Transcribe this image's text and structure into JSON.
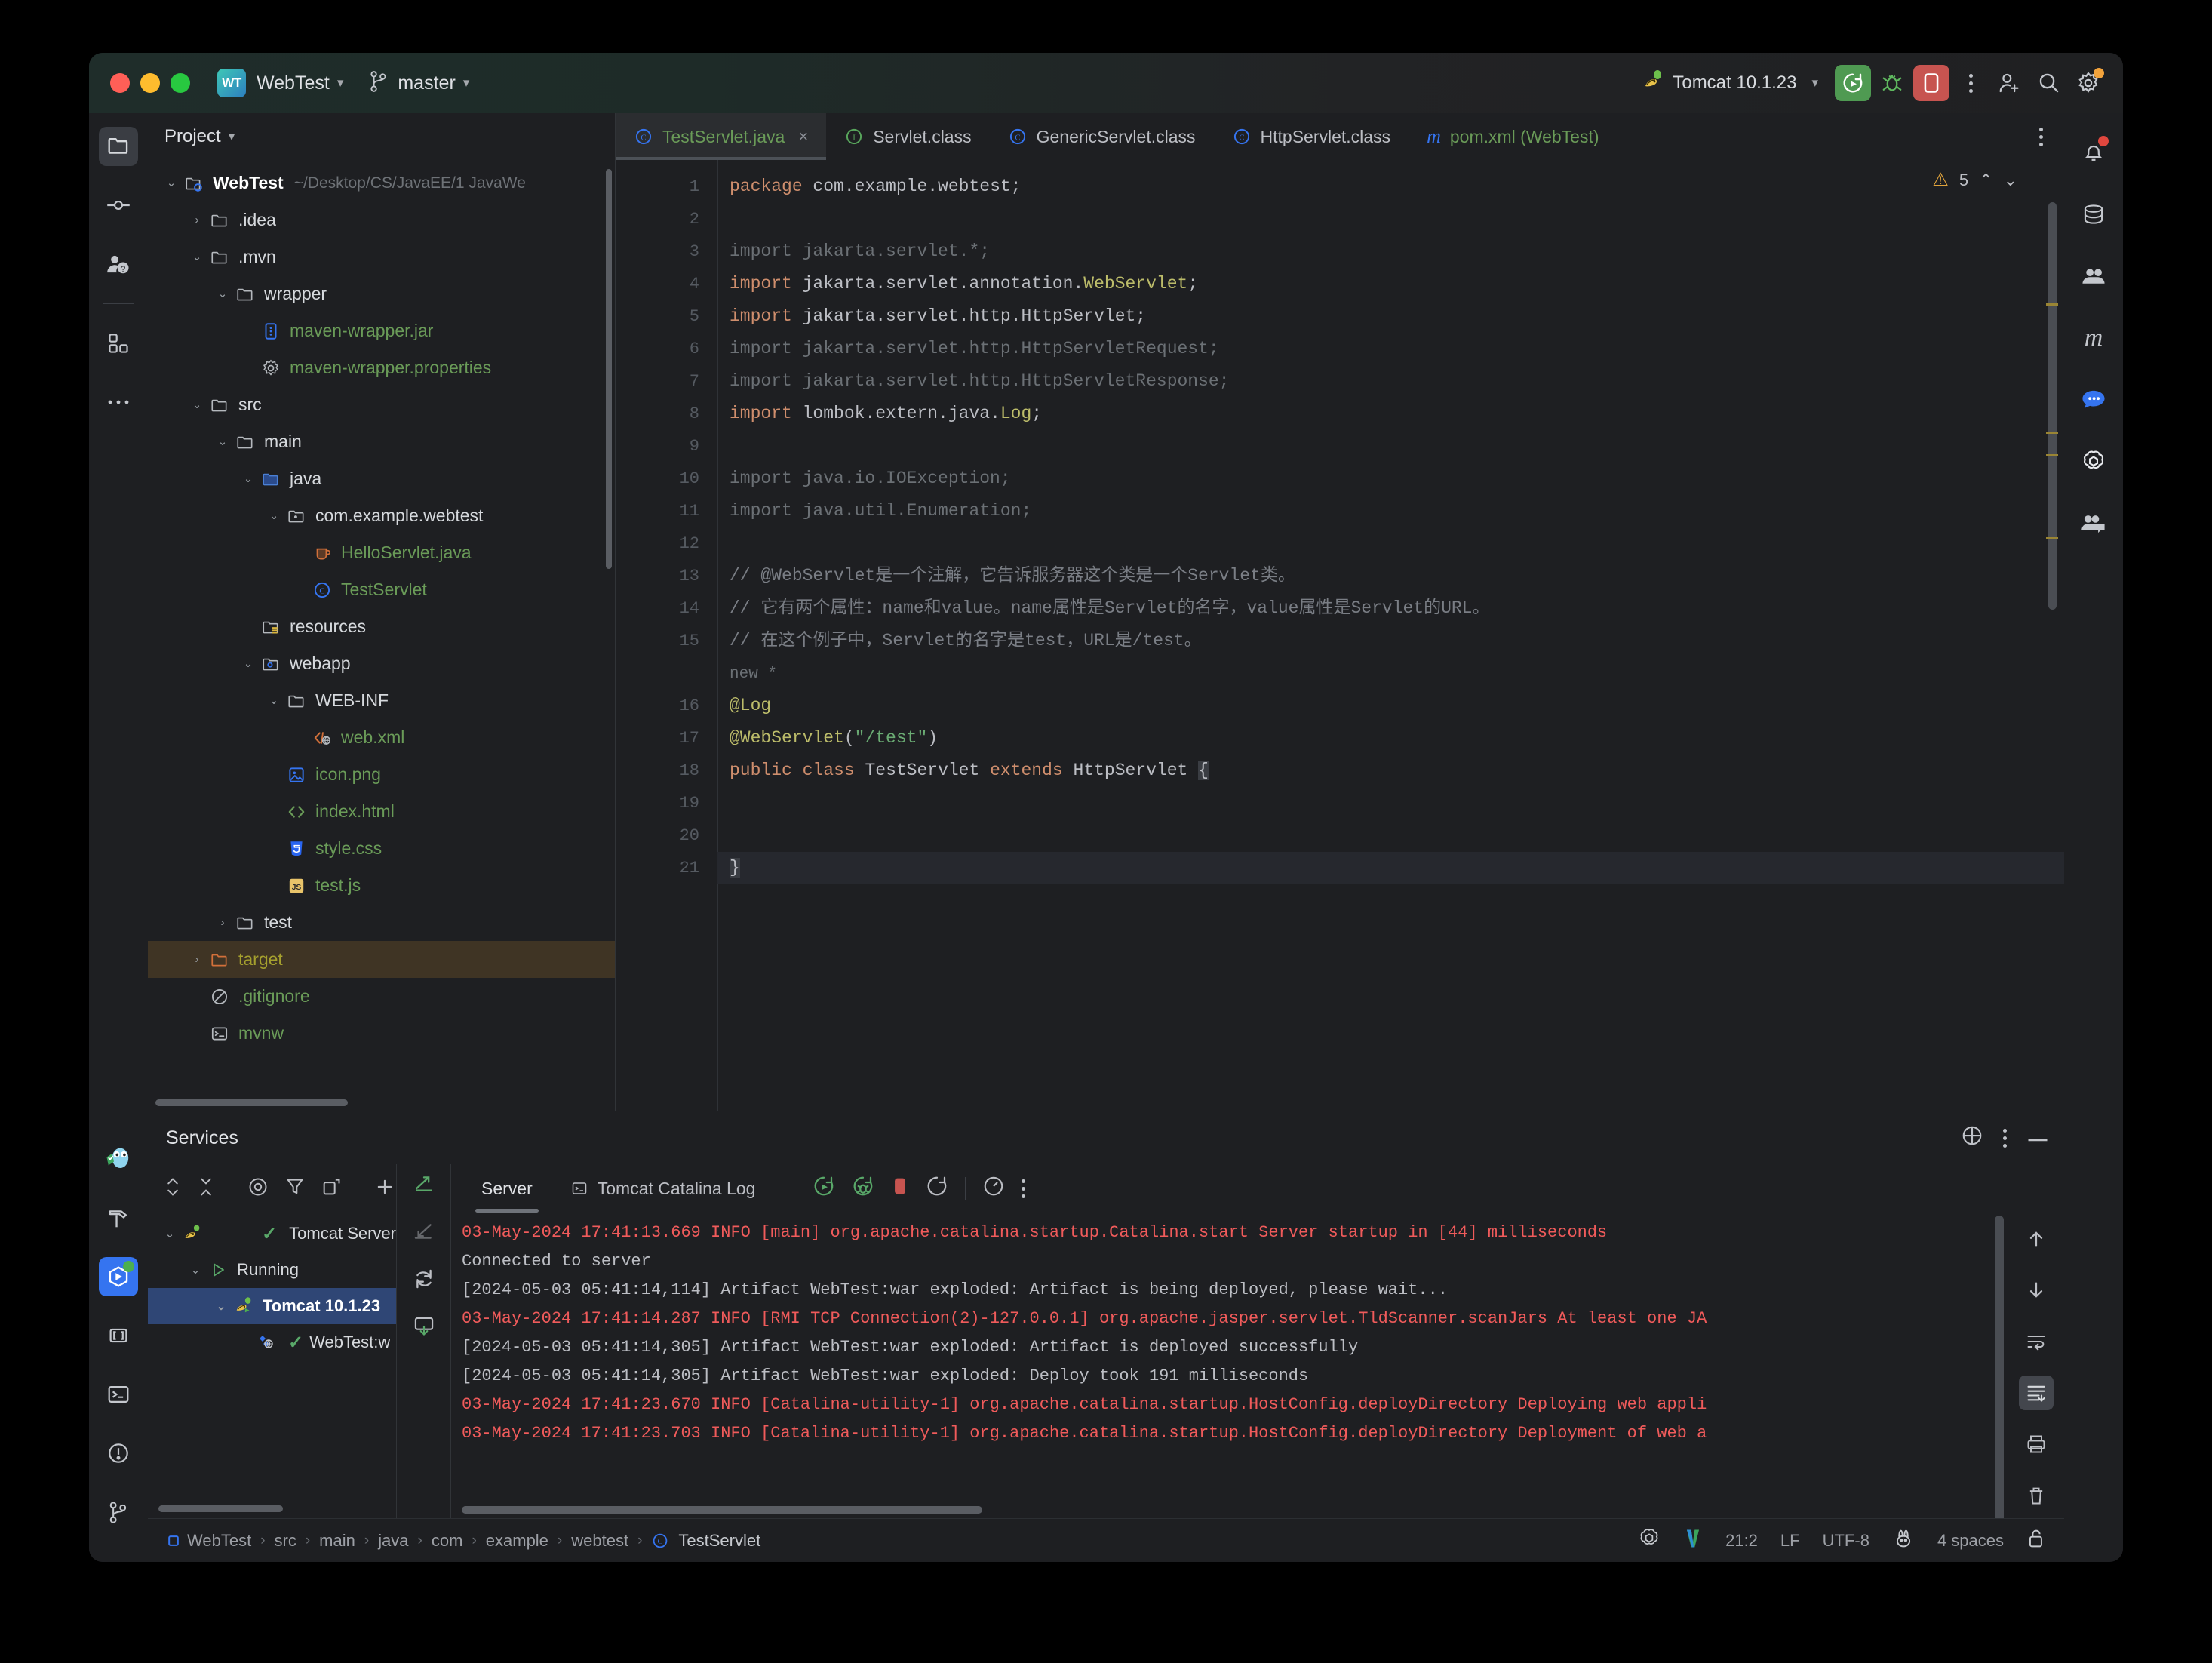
{
  "titlebar": {
    "project_badge": "WT",
    "project_name": "WebTest",
    "branch": "master",
    "run_config": "Tomcat 10.1.23"
  },
  "left_rail": [
    {
      "name": "project",
      "icon": "folder-icon"
    },
    {
      "name": "commit",
      "icon": "commit-icon"
    },
    {
      "name": "pull-requests",
      "icon": "pull-request-icon"
    },
    {
      "name": "plugins",
      "icon": "plugins-icon"
    },
    {
      "name": "more",
      "icon": "more-dots-icon"
    }
  ],
  "bottom_rail": [
    {
      "name": "go",
      "icon": "gopher-icon"
    },
    {
      "name": "build",
      "icon": "hammer-icon"
    },
    {
      "name": "services",
      "icon": "services-icon"
    },
    {
      "name": "bookmarks",
      "icon": "brackets-icon"
    },
    {
      "name": "terminal",
      "icon": "terminal-icon"
    },
    {
      "name": "problems",
      "icon": "exclamation-icon"
    },
    {
      "name": "git",
      "icon": "branch-icon"
    }
  ],
  "right_rail": [
    {
      "name": "notifications",
      "icon": "bell-icon"
    },
    {
      "name": "database",
      "icon": "database-icon"
    },
    {
      "name": "ai-assistant",
      "icon": "assistant-icon"
    },
    {
      "name": "maven",
      "icon": "maven-m-icon"
    },
    {
      "name": "chat",
      "icon": "chat-bubble-icon"
    },
    {
      "name": "openai",
      "icon": "openai-icon"
    },
    {
      "name": "collaboration",
      "icon": "collab-icon"
    }
  ],
  "project": {
    "title": "Project",
    "root_path": "~/Desktop/CS/JavaEE/1 JavaWe",
    "tree": [
      {
        "label": "WebTest",
        "depth": 0,
        "arrow": "down",
        "icon": "module-icon",
        "style": "bold"
      },
      {
        "label": ".idea",
        "depth": 1,
        "arrow": "right",
        "icon": "folder-icon",
        "style": ""
      },
      {
        "label": ".mvn",
        "depth": 1,
        "arrow": "down",
        "icon": "folder-icon",
        "style": ""
      },
      {
        "label": "wrapper",
        "depth": 2,
        "arrow": "down",
        "icon": "folder-icon",
        "style": ""
      },
      {
        "label": "maven-wrapper.jar",
        "depth": 3,
        "arrow": "none",
        "icon": "jar-icon",
        "style": "green"
      },
      {
        "label": "maven-wrapper.properties",
        "depth": 3,
        "arrow": "none",
        "icon": "properties-icon",
        "style": "green"
      },
      {
        "label": "src",
        "depth": 1,
        "arrow": "down",
        "icon": "folder-icon",
        "style": ""
      },
      {
        "label": "main",
        "depth": 2,
        "arrow": "down",
        "icon": "folder-icon",
        "style": ""
      },
      {
        "label": "java",
        "depth": 3,
        "arrow": "down",
        "icon": "source-root-icon",
        "style": ""
      },
      {
        "label": "com.example.webtest",
        "depth": 4,
        "arrow": "down",
        "icon": "package-icon",
        "style": ""
      },
      {
        "label": "HelloServlet.java",
        "depth": 5,
        "arrow": "none",
        "icon": "java-file-icon",
        "style": "green"
      },
      {
        "label": "TestServlet",
        "depth": 5,
        "arrow": "none",
        "icon": "class-icon",
        "style": "green"
      },
      {
        "label": "resources",
        "depth": 3,
        "arrow": "none",
        "icon": "resources-icon",
        "style": ""
      },
      {
        "label": "webapp",
        "depth": 3,
        "arrow": "down",
        "icon": "webapp-icon",
        "style": ""
      },
      {
        "label": "WEB-INF",
        "depth": 4,
        "arrow": "down",
        "icon": "folder-icon",
        "style": ""
      },
      {
        "label": "web.xml",
        "depth": 5,
        "arrow": "none",
        "icon": "xml-icon",
        "style": "green"
      },
      {
        "label": "icon.png",
        "depth": 4,
        "arrow": "none",
        "icon": "image-icon",
        "style": "green"
      },
      {
        "label": "index.html",
        "depth": 4,
        "arrow": "none",
        "icon": "html-icon",
        "style": "green"
      },
      {
        "label": "style.css",
        "depth": 4,
        "arrow": "none",
        "icon": "css-icon",
        "style": "green"
      },
      {
        "label": "test.js",
        "depth": 4,
        "arrow": "none",
        "icon": "js-icon",
        "style": "green"
      },
      {
        "label": "test",
        "depth": 2,
        "arrow": "right",
        "icon": "folder-icon",
        "style": ""
      },
      {
        "label": "target",
        "depth": 1,
        "arrow": "right",
        "icon": "excluded-folder-icon",
        "style": "olive selected"
      },
      {
        "label": ".gitignore",
        "depth": 1,
        "arrow": "none",
        "icon": "gitignore-icon",
        "style": "green"
      },
      {
        "label": "mvnw",
        "depth": 1,
        "arrow": "none",
        "icon": "shell-icon",
        "style": "green"
      }
    ]
  },
  "editor": {
    "tabs": [
      {
        "label": "TestServlet.java",
        "icon": "class-icon",
        "active": true,
        "closable": true
      },
      {
        "label": "Servlet.class",
        "icon": "interface-icon",
        "active": false,
        "closable": false
      },
      {
        "label": "GenericServlet.class",
        "icon": "class-icon",
        "active": false,
        "closable": false
      },
      {
        "label": "HttpServlet.class",
        "icon": "class-icon",
        "active": false,
        "closable": false
      },
      {
        "label": "pom.xml (WebTest)",
        "icon": "maven-m-icon",
        "active": false,
        "closable": false
      }
    ],
    "inspection_count": "5",
    "lines": [
      {
        "n": "1",
        "html": "<span class='k'>package</span> com.example.webtest;"
      },
      {
        "n": "2",
        "html": ""
      },
      {
        "n": "3",
        "html": "<span class='dim'>import jakarta.servlet.*;</span>"
      },
      {
        "n": "4",
        "html": "<span class='k'>import</span> jakarta.servlet.annotation.<span class='ann'>WebServlet</span>;"
      },
      {
        "n": "5",
        "html": "<span class='k'>import</span> jakarta.servlet.http.HttpServlet;"
      },
      {
        "n": "6",
        "html": "<span class='dim'>import jakarta.servlet.http.HttpServletRequest;</span>"
      },
      {
        "n": "7",
        "html": "<span class='dim'>import jakarta.servlet.http.HttpServletResponse;</span>"
      },
      {
        "n": "8",
        "html": "<span class='k'>import</span> lombok.extern.java.<span class='ann'>Log</span>;"
      },
      {
        "n": "9",
        "html": ""
      },
      {
        "n": "10",
        "html": "<span class='dim'>import java.io.IOException;</span>"
      },
      {
        "n": "11",
        "html": "<span class='dim'>import java.util.Enumeration;</span>"
      },
      {
        "n": "12",
        "html": ""
      },
      {
        "n": "13",
        "html": "<span class='c-com'>// @WebServlet是一个注解，它告诉服务器这个类是一个Servlet类。</span>"
      },
      {
        "n": "14",
        "html": "<span class='c-com'>// 它有两个属性：name和value。name属性是Servlet的名字，value属性是Servlet的URL。</span>"
      },
      {
        "n": "15",
        "html": "<span class='c-com'>// 在这个例子中，Servlet的名字是test，URL是/test。</span>"
      },
      {
        "n": "",
        "html": "<span class='hint'>new *</span>"
      },
      {
        "n": "16",
        "html": "<span class='ann'>@Log</span>"
      },
      {
        "n": "17",
        "html": "<span class='ann'>@WebServlet</span>(<span class='str'>\"/test\"</span>)"
      },
      {
        "n": "18",
        "html": "<span class='k'>public</span> <span class='k'>class</span> TestServlet <span class='k'>extends</span> HttpServlet <span class='brace-hl'>{</span>"
      },
      {
        "n": "19",
        "html": ""
      },
      {
        "n": "20",
        "html": ""
      },
      {
        "n": "21",
        "html": "<span class='brace-hl'>}</span>",
        "caret": true
      }
    ]
  },
  "services": {
    "title": "Services",
    "toolbar": [
      "expand-all",
      "collapse-all",
      "show-runtime",
      "filter",
      "new-tab",
      "add"
    ],
    "tree": [
      {
        "label": "Tomcat Server",
        "depth": 0,
        "arrow": "down",
        "icon": "tomcat-icon",
        "selected": false,
        "check": true
      },
      {
        "label": "Running",
        "depth": 1,
        "arrow": "down",
        "icon": "run-icon",
        "selected": false,
        "check": false
      },
      {
        "label": "Tomcat 10.1.23",
        "depth": 2,
        "arrow": "down",
        "icon": "tomcat-run-icon",
        "selected": true,
        "check": false
      },
      {
        "label": "WebTest:w",
        "depth": 3,
        "arrow": "none",
        "icon": "artifact-icon",
        "selected": false,
        "check": true
      }
    ],
    "tabs": [
      {
        "label": "Server",
        "icon": "",
        "active": true
      },
      {
        "label": "Tomcat Catalina Log",
        "icon": "terminal-icon",
        "active": false
      }
    ],
    "console": [
      {
        "text": "03-May-2024 17:41:13.669 INFO [main] org.apache.catalina.startup.Catalina.start Server startup in [44] milliseconds",
        "red": true
      },
      {
        "text": "Connected to server",
        "red": false
      },
      {
        "text": "[2024-05-03 05:41:14,114] Artifact WebTest:war exploded: Artifact is being deployed, please wait...",
        "red": false
      },
      {
        "text": "03-May-2024 17:41:14.287 INFO [RMI TCP Connection(2)-127.0.0.1] org.apache.jasper.servlet.TldScanner.scanJars At least one JA",
        "red": true
      },
      {
        "text": "[2024-05-03 05:41:14,305] Artifact WebTest:war exploded: Artifact is deployed successfully",
        "red": false
      },
      {
        "text": "[2024-05-03 05:41:14,305] Artifact WebTest:war exploded: Deploy took 191 milliseconds",
        "red": false
      },
      {
        "text": "03-May-2024 17:41:23.670 INFO [Catalina-utility-1] org.apache.catalina.startup.HostConfig.deployDirectory Deploying web appli",
        "red": true
      },
      {
        "text": "03-May-2024 17:41:23.703 INFO [Catalina-utility-1] org.apache.catalina.startup.HostConfig.deployDirectory Deployment of web a",
        "red": true
      }
    ],
    "console_side_icons": [
      "scroll-up",
      "scroll-down",
      "soft-wrap",
      "scroll-to-end",
      "print",
      "clear-all"
    ]
  },
  "statusbar": {
    "breadcrumbs": [
      "WebTest",
      "src",
      "main",
      "java",
      "com",
      "example",
      "webtest",
      "TestServlet"
    ],
    "caret_position": "21:2",
    "line_separator": "LF",
    "encoding": "UTF-8",
    "indent": "4 spaces"
  },
  "colors": {
    "accent_blue": "#3574f0",
    "run_green": "#4f9a52",
    "stop_red": "#c75450",
    "vcs_green": "#6a9b58",
    "warning_orange": "#e0a33c",
    "log_red": "#f05b5b",
    "selection_blue": "#2f4675",
    "selection_brown": "#3f3424"
  }
}
